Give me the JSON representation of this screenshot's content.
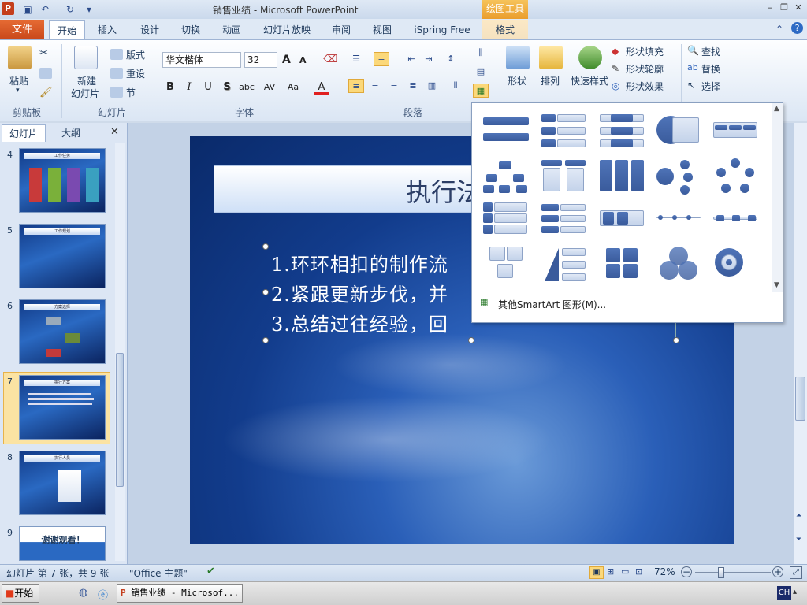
{
  "titlebar": {
    "app_icon": "P",
    "title": "销售业绩 - Microsoft PowerPoint",
    "context_tab": "绘图工具"
  },
  "tabs": {
    "file": "文件",
    "home": "开始",
    "insert": "插入",
    "design": "设计",
    "transitions": "切换",
    "animations": "动画",
    "slideshow": "幻灯片放映",
    "review": "审阅",
    "view": "视图",
    "ispring": "iSpring Free",
    "format": "格式"
  },
  "ribbon": {
    "clipboard": {
      "paste": "粘贴",
      "label": "剪贴板"
    },
    "slides": {
      "new_slide_1": "新建",
      "new_slide_2": "幻灯片",
      "layout": "版式",
      "reset": "重设",
      "section": "节",
      "label": "幻灯片"
    },
    "font": {
      "name": "华文楷体",
      "size": "32",
      "bold": "B",
      "italic": "I",
      "underline": "U",
      "shadow": "S",
      "strike": "abc",
      "spacing": "AV",
      "case": "Aa",
      "color": "A",
      "grow": "A",
      "shrink": "A",
      "label": "字体"
    },
    "paragraph": {
      "label": "段落"
    },
    "drawing": {
      "shapes": "形状",
      "arrange": "排列",
      "quick_styles": "快速样式",
      "fill": "形状填充",
      "outline": "形状轮廓",
      "effects": "形状效果"
    },
    "editing": {
      "find": "查找",
      "replace": "替换",
      "select": "选择"
    }
  },
  "panel": {
    "tab_slides": "幻灯片",
    "tab_outline": "大纲",
    "close": "✕",
    "thumbs": [
      {
        "num": "4",
        "title": "工作任务"
      },
      {
        "num": "5",
        "title": "工作规划"
      },
      {
        "num": "6",
        "title": "方案选择"
      },
      {
        "num": "7",
        "title": "执行方案"
      },
      {
        "num": "8",
        "title": "执行人员"
      },
      {
        "num": "9",
        "title": "谢谢观看！"
      }
    ]
  },
  "slide": {
    "title": "执行法",
    "lines": [
      "1.环环相扣的制作流",
      "2.紧跟更新步伐，并",
      "3.总结过往经验，回"
    ]
  },
  "dropdown": {
    "more": "其他SmartArt 图形(M)..."
  },
  "status": {
    "slide_info": "幻灯片 第 7 张，共 9 张",
    "theme": "\"Office 主题\"",
    "zoom": "72%",
    "zoom_level": 0.72
  },
  "taskbar": {
    "start": "开始",
    "app": "销售业绩 - Microsof...",
    "lang": "CH"
  },
  "colors": {
    "file_tab": "#c9481b",
    "accent": "#2a5fb8",
    "context": "#e99a2a"
  }
}
